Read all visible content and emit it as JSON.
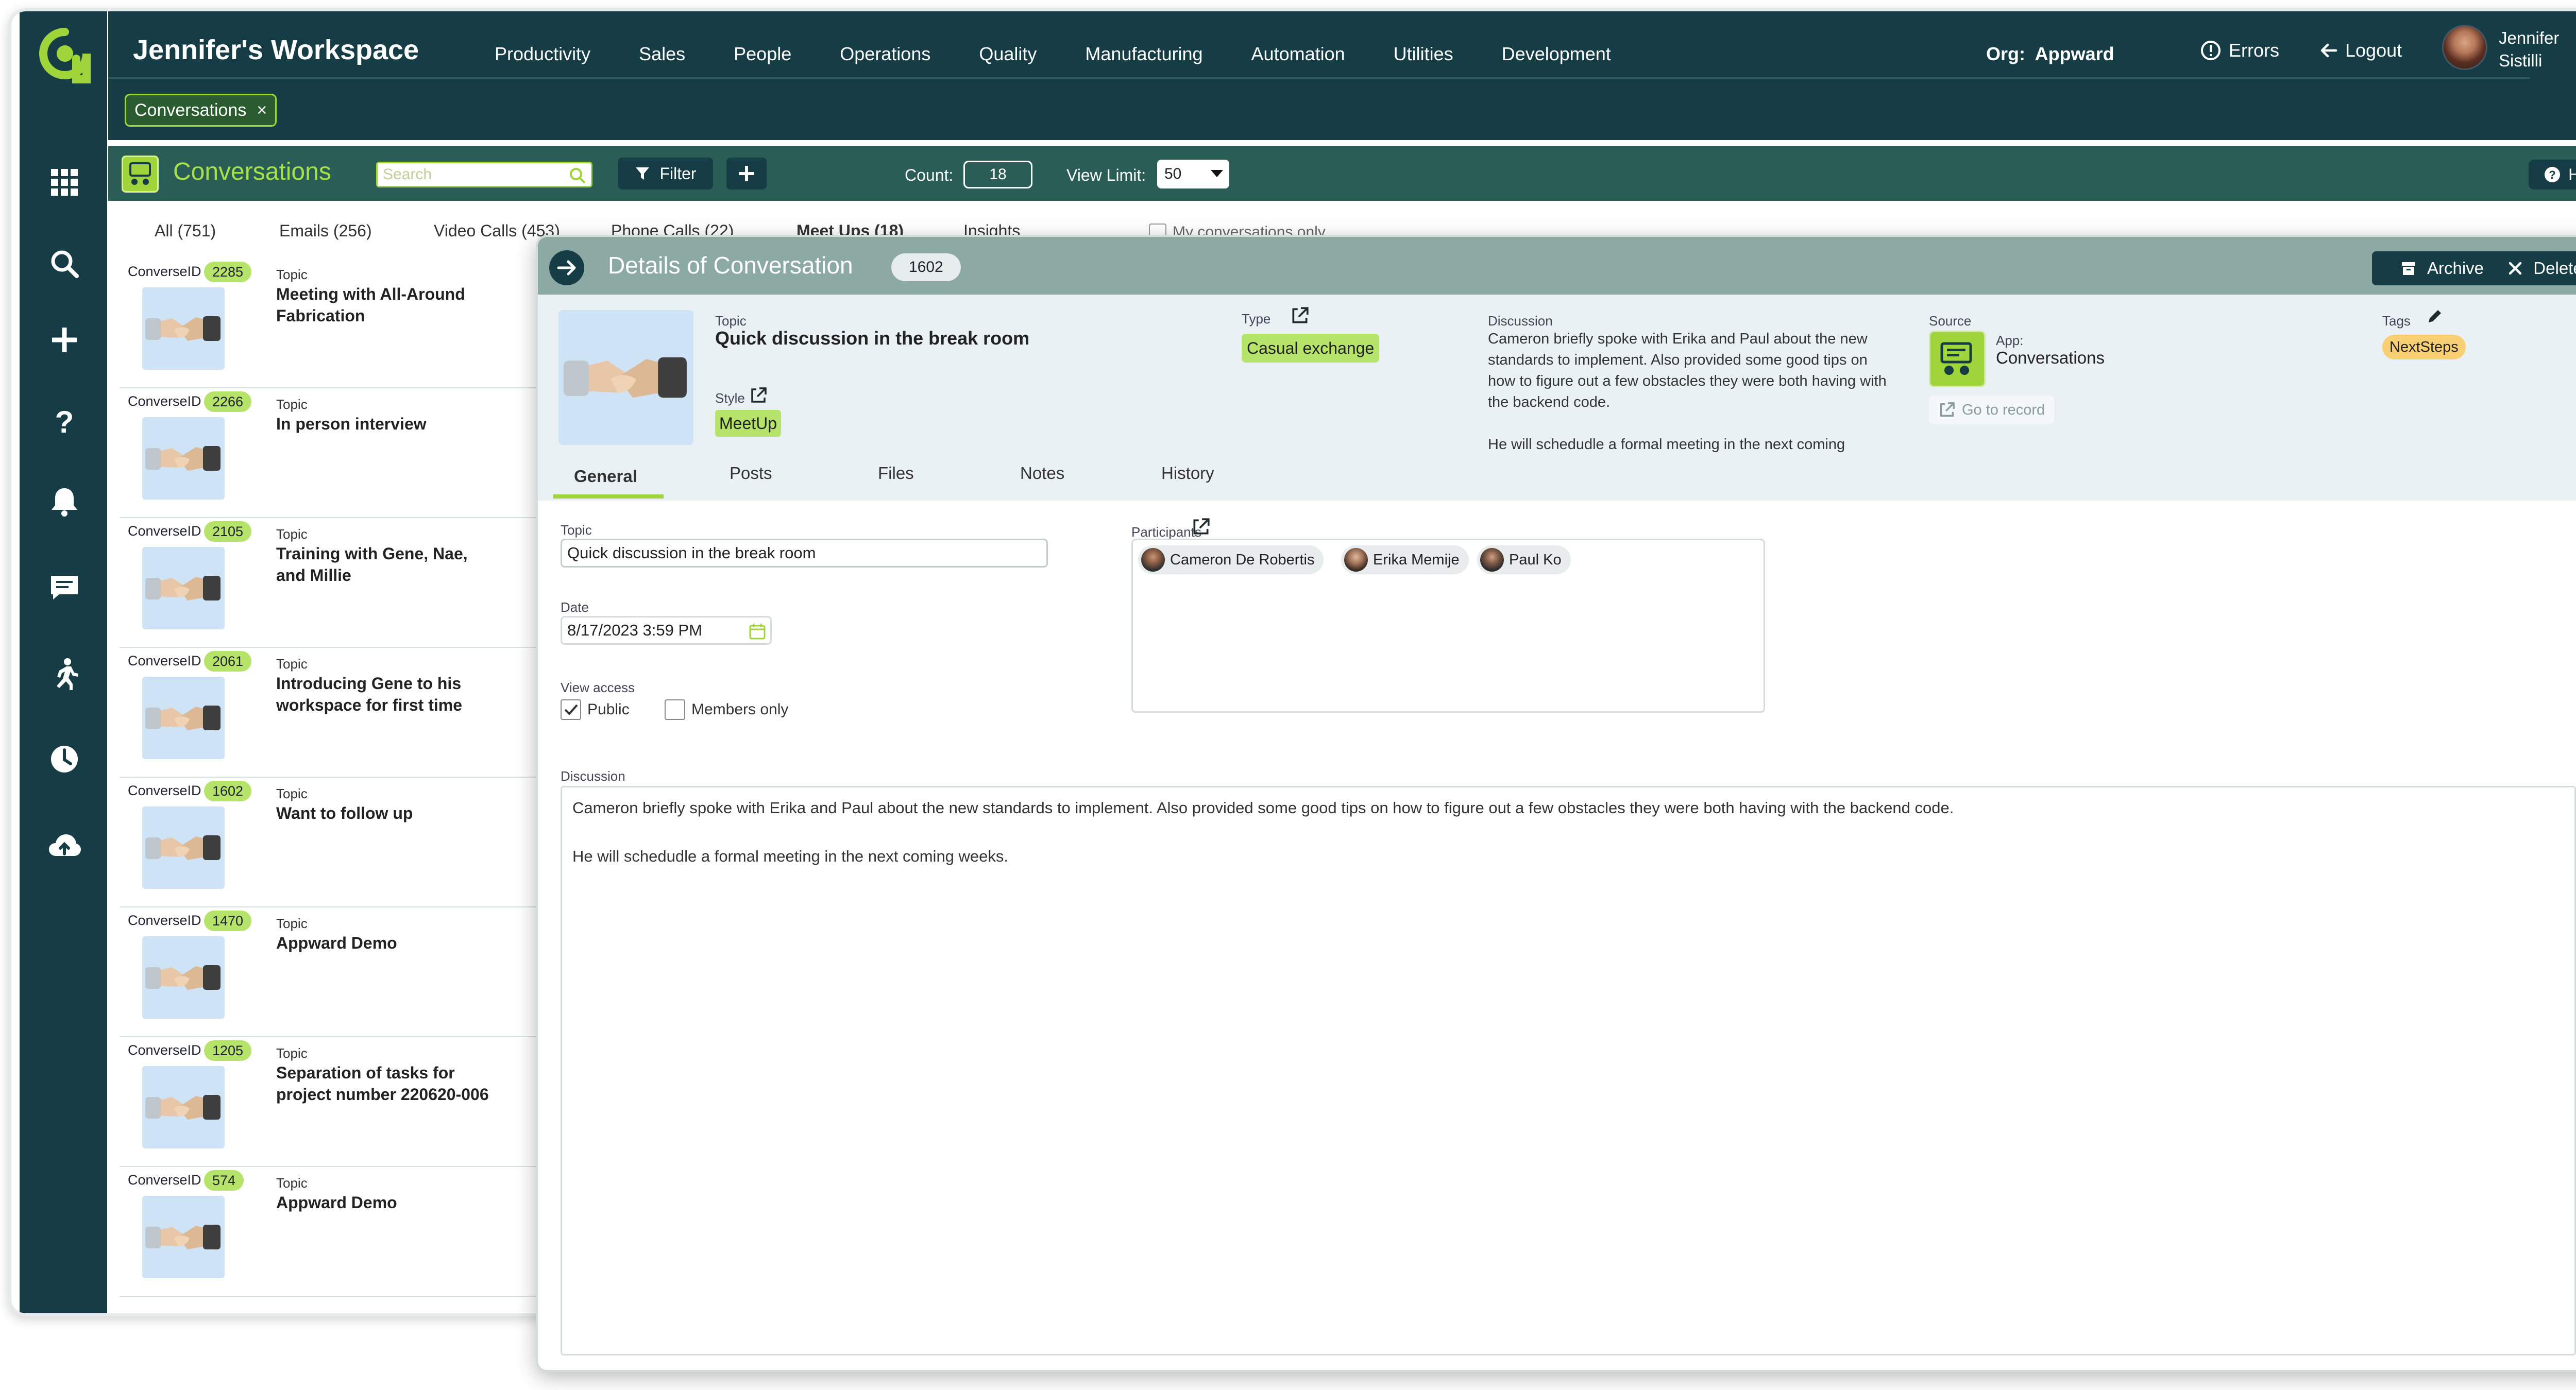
{
  "header": {
    "workspace_title": "Jennifer's Workspace",
    "nav": [
      "Productivity",
      "Sales",
      "People",
      "Operations",
      "Quality",
      "Manufacturing",
      "Automation",
      "Utilities",
      "Development"
    ],
    "org_label": "Org:",
    "org_name": "Appward",
    "errors_label": "Errors",
    "logout_label": "Logout",
    "user_first": "Jennifer",
    "user_last": "Sistilli",
    "open_tab": "Conversations",
    "open_tab_close": "×"
  },
  "sidebar": {
    "icons": [
      "apps-grid-icon",
      "search-icon",
      "plus-icon",
      "help-icon",
      "bell-icon",
      "chat-icon",
      "activity-icon",
      "clock-icon",
      "cloud-upload-icon"
    ]
  },
  "toolbar": {
    "title": "Conversations",
    "search_placeholder": "Search",
    "filter_label": "Filter",
    "count_label": "Count:",
    "count_value": "18",
    "view_limit_label": "View Limit:",
    "view_limit_value": "50",
    "help_label": "Help"
  },
  "list_tabs": [
    "All (751)",
    "Emails (256)",
    "Video Calls (453)",
    "Phone Calls (22)",
    "Meet Ups (18)",
    "Insights"
  ],
  "my_conversations_label": "My conversations only",
  "list": {
    "id_label": "ConverseID",
    "topic_label": "Topic",
    "items": [
      {
        "id": "2285",
        "topic": "Meeting with All-Around Fabrication"
      },
      {
        "id": "2266",
        "topic": "In person interview"
      },
      {
        "id": "2105",
        "topic": "Training with Gene, Nae, and Millie"
      },
      {
        "id": "2061",
        "topic": "Introducing Gene to his workspace for first time"
      },
      {
        "id": "1602",
        "topic": "Want to follow up"
      },
      {
        "id": "1470",
        "topic": "Appward Demo"
      },
      {
        "id": "1205",
        "topic": "Separation of tasks for project number 220620-006"
      },
      {
        "id": "574",
        "topic": "Appward Demo"
      }
    ]
  },
  "detail": {
    "title": "Details of Conversation",
    "id": "1602",
    "archive_label": "Archive",
    "delete_label": "Delete",
    "topic_label": "Topic",
    "topic": "Quick discussion in the break room",
    "style_label": "Style",
    "style": "MeetUp",
    "type_label": "Type",
    "type": "Casual exchange",
    "discussion_label": "Discussion",
    "discussion_preview": "Cameron briefly spoke with Erika and Paul about the new standards to implement. Also provided some good tips on how to figure out a few obstacles they were both having with the backend code.\n\nHe will schedudle a formal meeting in the next coming",
    "source_label": "Source",
    "app_label": "App:",
    "app_name": "Conversations",
    "goto_label": "Go to record",
    "tags_label": "Tags",
    "tag": "NextSteps",
    "tabs": [
      "General",
      "Posts",
      "Files",
      "Notes",
      "History"
    ],
    "form": {
      "topic_label": "Topic",
      "topic_value": "Quick discussion in the break room",
      "date_label": "Date",
      "date_value": "8/17/2023 3:59 PM",
      "view_access_label": "View access",
      "public_label": "Public",
      "members_label": "Members only",
      "participants_label": "Participants",
      "participants": [
        "Cameron De Robertis",
        "Erika Memije",
        "Paul Ko"
      ],
      "discussion_label": "Discussion",
      "discussion_value": "Cameron briefly spoke with Erika and Paul about the new standards to implement. Also provided some good tips on how to figure out a few obstacles they were both having with the backend code.\n\nHe will schedudle a formal meeting in the next coming weeks."
    }
  },
  "colors": {
    "dark_teal": "#163d45",
    "toolbar_green": "#2a5d56",
    "accent_lime": "#9fd43b",
    "badge_green": "#b6e36a",
    "tag_orange": "#f8cf73",
    "detail_header": "#8da9a4"
  }
}
